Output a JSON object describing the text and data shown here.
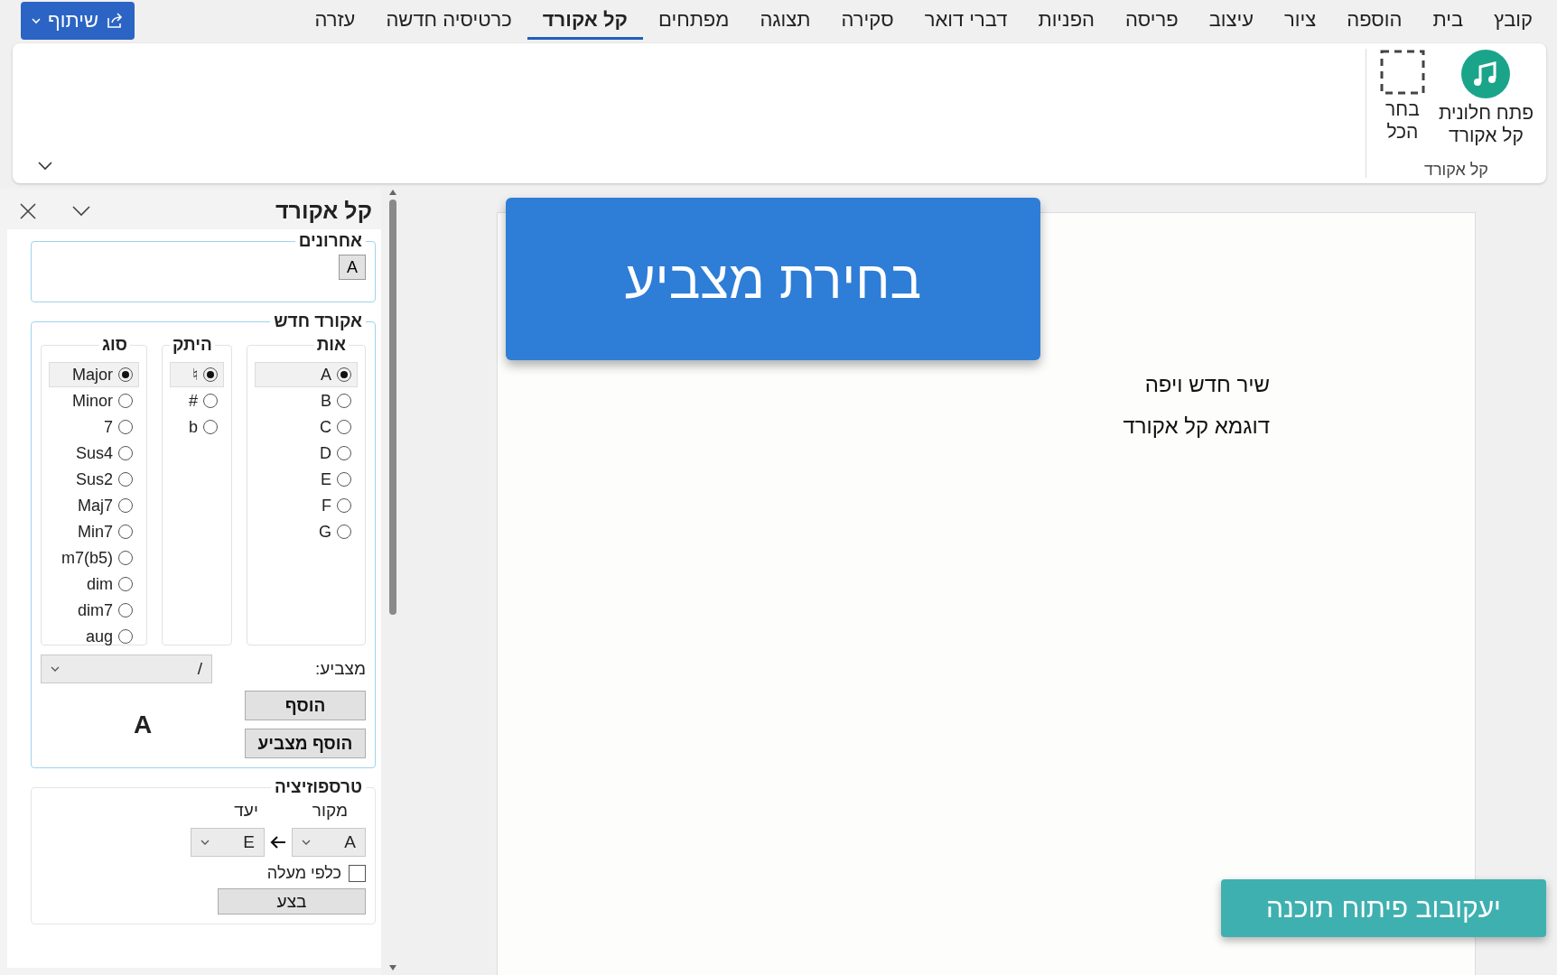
{
  "menu_tabs": [
    {
      "label": "קובץ",
      "selected": false
    },
    {
      "label": "בית",
      "selected": false
    },
    {
      "label": "הוספה",
      "selected": false
    },
    {
      "label": "ציור",
      "selected": false
    },
    {
      "label": "עיצוב",
      "selected": false
    },
    {
      "label": "פריסה",
      "selected": false
    },
    {
      "label": "הפניות",
      "selected": false
    },
    {
      "label": "דברי דואר",
      "selected": false
    },
    {
      "label": "סקירה",
      "selected": false
    },
    {
      "label": "תצוגה",
      "selected": false
    },
    {
      "label": "מפתחים",
      "selected": false
    },
    {
      "label": "קל אקורד",
      "selected": true
    },
    {
      "label": "כרטיסיה חדשה",
      "selected": false
    },
    {
      "label": "עזרה",
      "selected": false
    }
  ],
  "share_button": {
    "label": "שיתוף"
  },
  "ribbon": {
    "group_label": "קל אקורד",
    "buttons": [
      {
        "kind": "music",
        "lines": [
          "פתח חלונית",
          "קל אקורד"
        ]
      },
      {
        "kind": "select",
        "lines": [
          "בחר",
          "הכל"
        ]
      }
    ]
  },
  "pane": {
    "title": "קל אקורד",
    "recent": {
      "legend": "אחרונים",
      "chords": [
        "A"
      ]
    },
    "new_chord": {
      "legend": "אקורד חדש",
      "letter": {
        "legend": "אות",
        "options": [
          {
            "label": "A",
            "selected": true
          },
          {
            "label": "B",
            "selected": false
          },
          {
            "label": "C",
            "selected": false
          },
          {
            "label": "D",
            "selected": false
          },
          {
            "label": "E",
            "selected": false
          },
          {
            "label": "F",
            "selected": false
          },
          {
            "label": "G",
            "selected": false
          }
        ]
      },
      "accidental": {
        "legend": "היתק",
        "options": [
          {
            "label": "♮",
            "selected": true
          },
          {
            "label": "#",
            "selected": false
          },
          {
            "label": "b",
            "selected": false
          }
        ]
      },
      "type": {
        "legend": "סוג",
        "options": [
          {
            "label": "Major",
            "selected": true
          },
          {
            "label": "Minor",
            "selected": false
          },
          {
            "label": "7",
            "selected": false
          },
          {
            "label": "Sus4",
            "selected": false
          },
          {
            "label": "Sus2",
            "selected": false
          },
          {
            "label": "Maj7",
            "selected": false
          },
          {
            "label": "Min7",
            "selected": false
          },
          {
            "label": "m7(b5)",
            "selected": false
          },
          {
            "label": "dim",
            "selected": false
          },
          {
            "label": "dim7",
            "selected": false
          },
          {
            "label": "aug",
            "selected": false
          }
        ]
      },
      "pointer_label": "מצביע:",
      "pointer_value": "/",
      "preview": "A",
      "add_button": "הוסף",
      "add_pointer_button": "הוסף מצביע"
    },
    "transposition": {
      "legend": "טרספוזיציה",
      "source_label": "מקור",
      "target_label": "יעד",
      "source_value": "A",
      "target_value": "E",
      "upward": {
        "label": "כלפי מעלה",
        "checked": false
      },
      "apply_button": "בצע"
    }
  },
  "document": {
    "lines": [
      "שיר חדש ויפה",
      "דוגמא קל אקורד"
    ]
  },
  "overlay_banner": "בחירת מצביע",
  "overlay_brand": "יעקובוב פיתוח תוכנה"
}
